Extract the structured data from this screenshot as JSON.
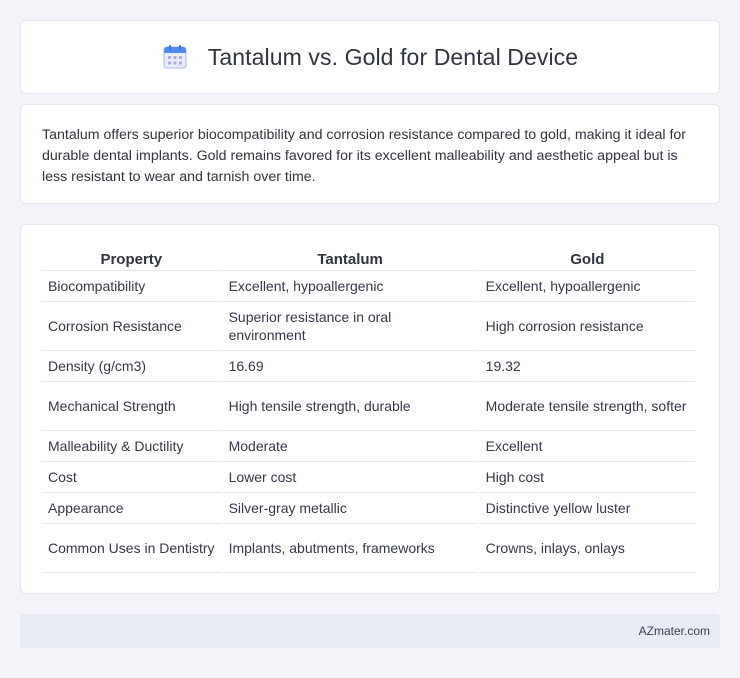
{
  "header": {
    "title": "Tantalum vs. Gold for Dental Device",
    "icon": "calendar-icon",
    "icon_colors": {
      "top": "#4f8ef0",
      "body": "#e8eefc",
      "dots": "#b9a4ea"
    }
  },
  "summary": {
    "text": "Tantalum offers superior biocompatibility and corrosion resistance compared to gold, making it ideal for durable dental implants. Gold remains favored for its excellent malleability and aesthetic appeal but is less resistant to wear and tarnish over time."
  },
  "table": {
    "headers": [
      "Property",
      "Tantalum",
      "Gold"
    ],
    "rows": [
      [
        "Biocompatibility",
        "Excellent, hypoallergenic",
        "Excellent, hypoallergenic"
      ],
      [
        "Corrosion Resistance",
        "Superior resistance in oral environment",
        "High corrosion resistance"
      ],
      [
        "Density (g/cm3)",
        "16.69",
        "19.32"
      ],
      [
        "Mechanical Strength",
        "High tensile strength, durable",
        "Moderate tensile strength, softer"
      ],
      [
        "Malleability & Ductility",
        "Moderate",
        "Excellent"
      ],
      [
        "Cost",
        "Lower cost",
        "High cost"
      ],
      [
        "Appearance",
        "Silver-gray metallic",
        "Distinctive yellow luster"
      ],
      [
        "Common Uses in Dentistry",
        "Implants, abutments, frameworks",
        "Crowns, inlays, onlays"
      ]
    ]
  },
  "footer": {
    "text": "AZmater.com"
  }
}
